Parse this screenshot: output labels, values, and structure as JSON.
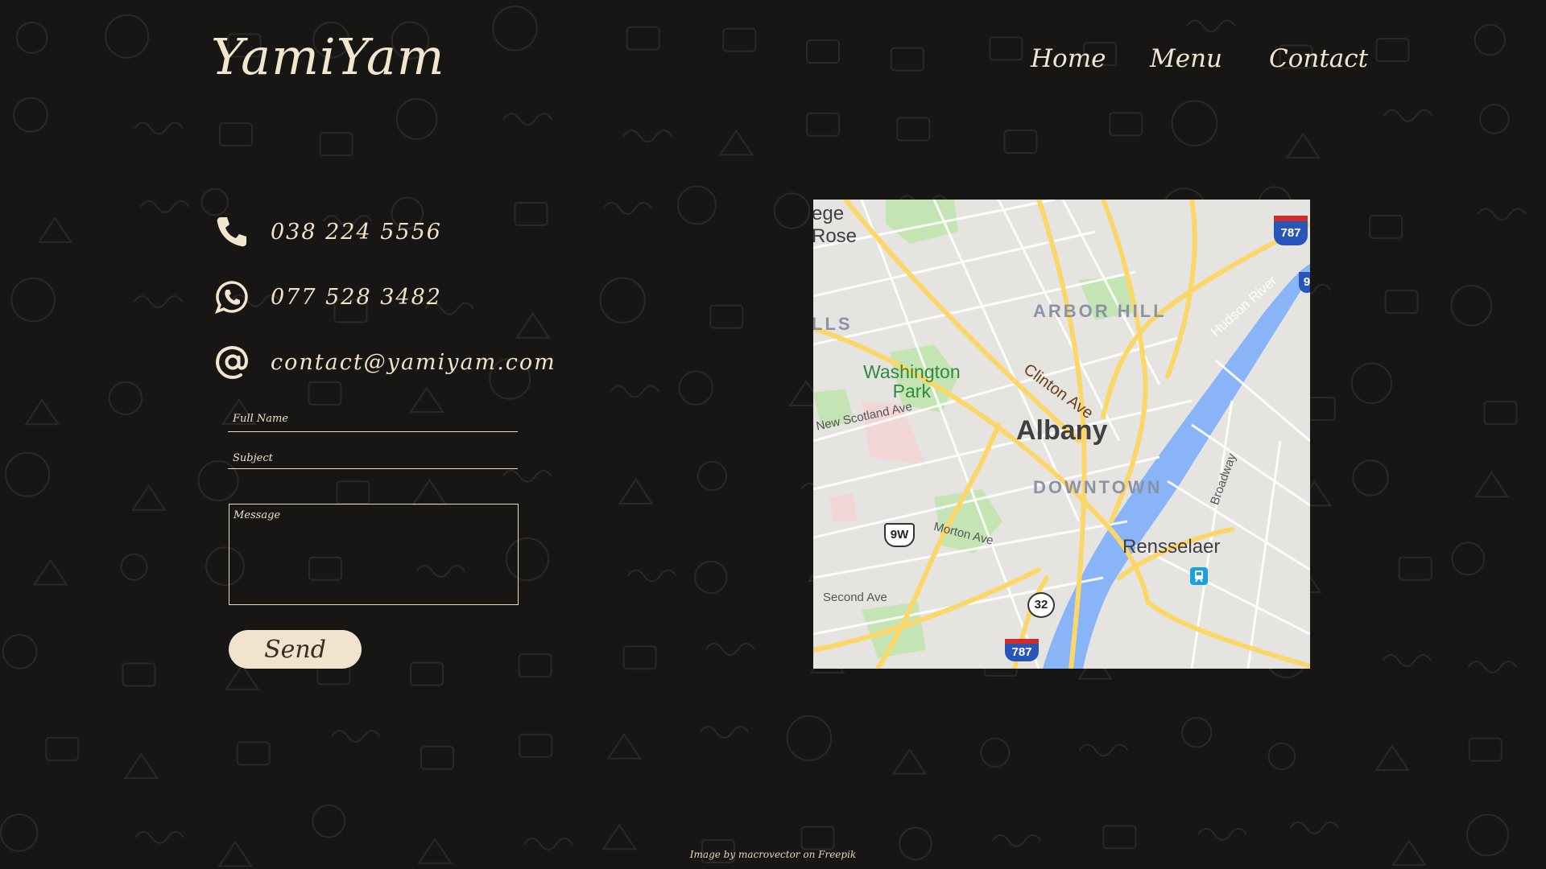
{
  "header": {
    "logo": "YamiYam",
    "nav": [
      "Home",
      "Menu",
      "Contact"
    ]
  },
  "contact": {
    "phone": "038 224 5556",
    "whatsapp": "077 528 3482",
    "email": "contact@yamiyam.com"
  },
  "form": {
    "full_name_placeholder": "Full Name",
    "subject_placeholder": "Subject",
    "message_placeholder": "Message",
    "send_label": "Send"
  },
  "map": {
    "labels": {
      "top_left_1": "ege",
      "top_left_2": "Rose",
      "left_edge": "LLS",
      "arbor_hill": "ARBOR HILL",
      "clinton_ave": "Clinton Ave",
      "hudson_river": "Hudson River",
      "washington_park_1": "Washington",
      "washington_park_2": "Park",
      "new_scotland_ave": "New Scotland Ave",
      "albany": "Albany",
      "downtown": "DOWNTOWN",
      "broadway": "Broadway",
      "morton_ave": "Morton Ave",
      "rensselaer": "Rensselaer",
      "second_ave": "Second Ave"
    },
    "shields": {
      "i787_top": "787",
      "i9_edge": "9",
      "us9w": "9W",
      "rt32": "32",
      "i787_bottom": "787"
    },
    "colors": {
      "land": "#e6e4e0",
      "road": "#fbd76a",
      "water": "#8ab4f8",
      "park": "#c5e4b4"
    }
  },
  "footer": {
    "credit": "Image by macrovector on Freepik"
  },
  "colors": {
    "background": "#181614",
    "cream": "#f1e2c8",
    "button_text": "#3b2c24"
  }
}
